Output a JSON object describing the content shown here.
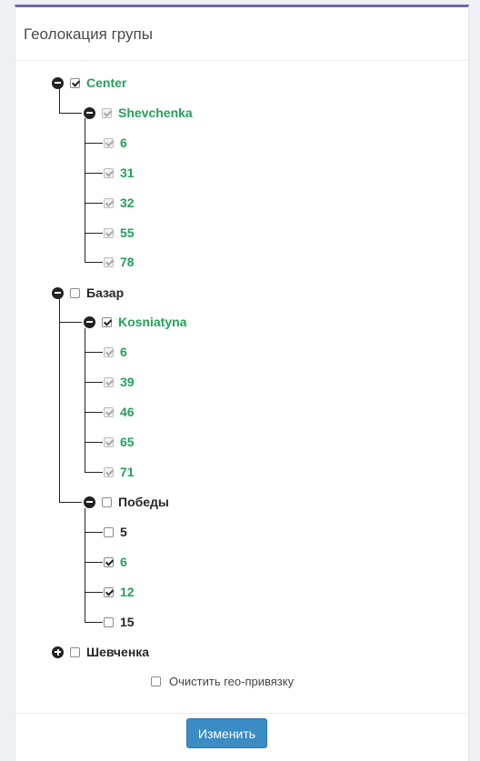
{
  "panel": {
    "title": "Геолокация групы"
  },
  "tree": {
    "center": {
      "label": "Center",
      "shevchenka": {
        "label": "Shevchenka",
        "children": [
          "6",
          "31",
          "32",
          "55",
          "78"
        ]
      }
    },
    "bazar": {
      "label": "Базар",
      "kosniatyna": {
        "label": "Kosniatyna",
        "children": [
          "6",
          "39",
          "46",
          "65",
          "71"
        ]
      },
      "pobedy": {
        "label": "Победы",
        "children": [
          "5",
          "6",
          "12",
          "15"
        ]
      }
    },
    "shevchenka_ua": {
      "label": "Шевченка"
    }
  },
  "clear_geo": {
    "label": "Очистить гео-привязку"
  },
  "submit": {
    "label": "Изменить"
  },
  "colors": {
    "accent": "#6e6aae",
    "selected_text": "#24a05a",
    "button": "#3a8cc4"
  }
}
